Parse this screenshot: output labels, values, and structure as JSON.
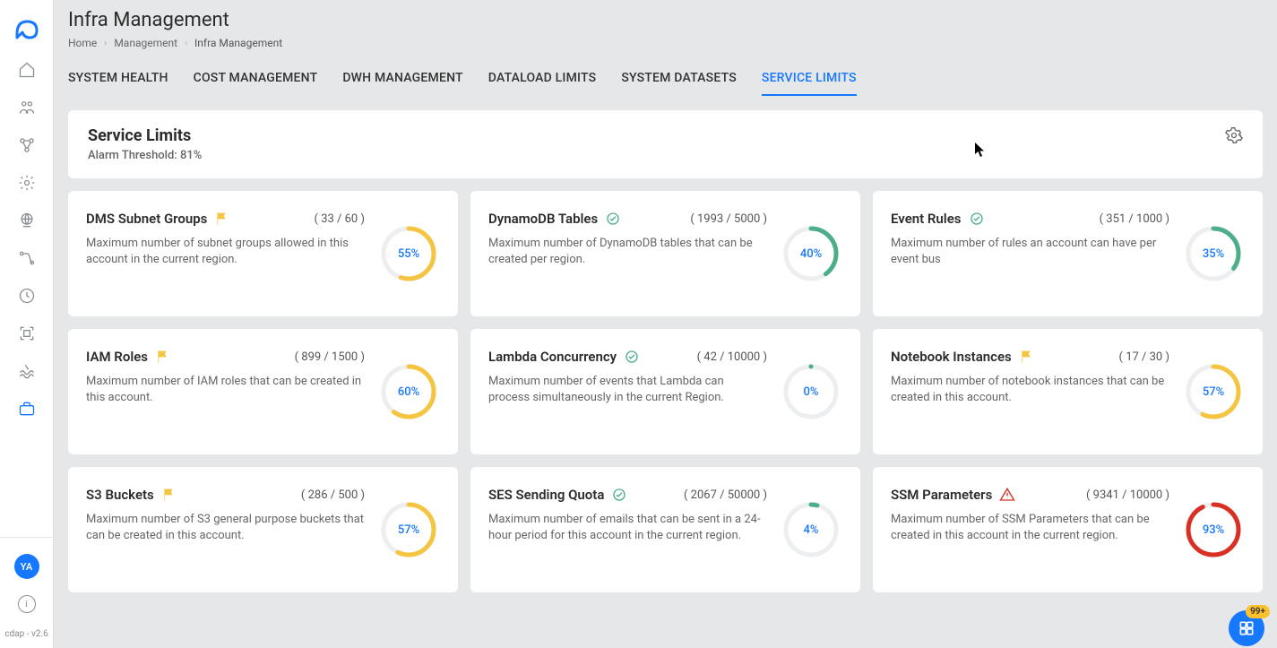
{
  "page": {
    "title": "Infra Management",
    "breadcrumb": [
      "Home",
      "Management",
      "Infra Management"
    ]
  },
  "sidebar": {
    "avatar": "YA",
    "version": "cdap - v2.6"
  },
  "tabs": [
    {
      "label": "SYSTEM HEALTH",
      "active": false
    },
    {
      "label": "COST MANAGEMENT",
      "active": false
    },
    {
      "label": "DWH MANAGEMENT",
      "active": false
    },
    {
      "label": "DATALOAD LIMITS",
      "active": false
    },
    {
      "label": "SYSTEM DATASETS",
      "active": false
    },
    {
      "label": "SERVICE LIMITS",
      "active": true
    }
  ],
  "panel": {
    "title": "Service Limits",
    "threshold_label": "Alarm Threshold: 81%"
  },
  "cards": [
    {
      "title": "DMS Subnet Groups",
      "status": "flag",
      "used": 33,
      "limit": 60,
      "percent": 55,
      "color": "#f5c542",
      "label_color": "#1677ff",
      "desc": "Maximum number of subnet groups allowed in this account in the current region."
    },
    {
      "title": "DynamoDB Tables",
      "status": "check",
      "used": 1993,
      "limit": 5000,
      "percent": 40,
      "color": "#4caf89",
      "label_color": "#1677ff",
      "desc": "Maximum number of DynamoDB tables that can be created per region."
    },
    {
      "title": "Event Rules",
      "status": "check",
      "used": 351,
      "limit": 1000,
      "percent": 35,
      "color": "#4caf89",
      "label_color": "#1677ff",
      "desc": "Maximum number of rules an account can have per event bus"
    },
    {
      "title": "IAM Roles",
      "status": "flag",
      "used": 899,
      "limit": 1500,
      "percent": 60,
      "color": "#f5c542",
      "label_color": "#1677ff",
      "desc": "Maximum number of IAM roles that can be created in this account."
    },
    {
      "title": "Lambda Concurrency",
      "status": "check",
      "used": 42,
      "limit": 10000,
      "percent": 0,
      "color": "#4caf89",
      "label_color": "#1677ff",
      "desc": "Maximum number of events that Lambda can process simultaneously in the current Region."
    },
    {
      "title": "Notebook Instances",
      "status": "flag",
      "used": 17,
      "limit": 30,
      "percent": 57,
      "color": "#f5c542",
      "label_color": "#1677ff",
      "desc": "Maximum number of notebook instances that can be created in this account."
    },
    {
      "title": "S3 Buckets",
      "status": "flag",
      "used": 286,
      "limit": 500,
      "percent": 57,
      "color": "#f5c542",
      "label_color": "#1677ff",
      "desc": "Maximum number of S3 general purpose buckets that can be created in this account."
    },
    {
      "title": "SES Sending Quota",
      "status": "check",
      "used": 2067,
      "limit": 50000,
      "percent": 4,
      "color": "#4caf89",
      "label_color": "#1677ff",
      "desc": "Maximum number of emails that can be sent in a 24-hour period for this account in the current region."
    },
    {
      "title": "SSM Parameters",
      "status": "alert",
      "used": 9341,
      "limit": 10000,
      "percent": 93,
      "color": "#d93025",
      "label_color": "#1677ff",
      "desc": "Maximum number of SSM Parameters that can be created in this account in the current region."
    }
  ],
  "fab": {
    "badge": "99+"
  }
}
